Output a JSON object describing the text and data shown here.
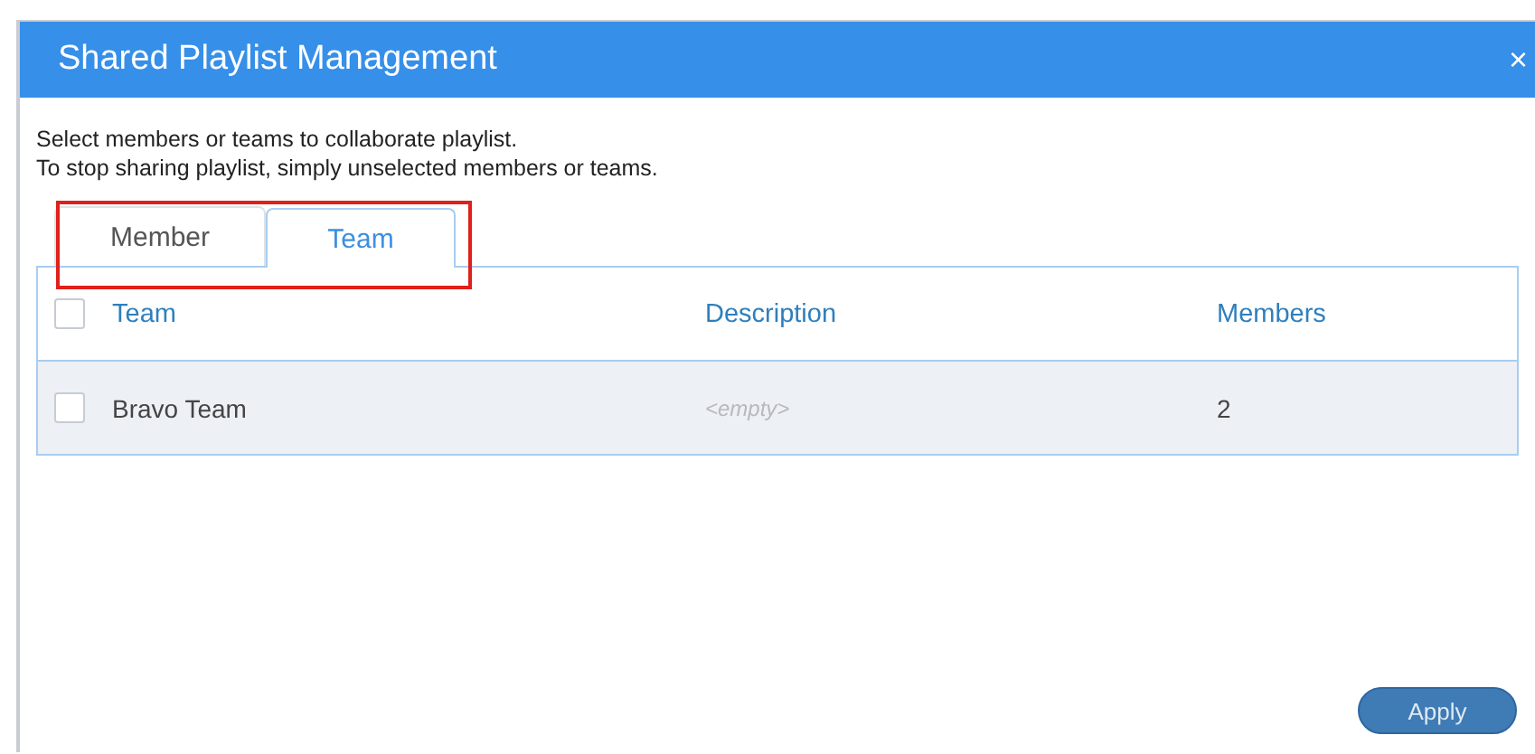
{
  "window": {
    "title": "Shared Playlist Management",
    "close": "×"
  },
  "instructions": [
    "Select members or teams to collaborate playlist.",
    "To stop sharing playlist, simply unselected members or teams."
  ],
  "tabs": [
    {
      "label": "Member",
      "selected": false
    },
    {
      "label": "Team",
      "selected": true
    }
  ],
  "table": {
    "select_all_checked": false,
    "columns": [
      "Team",
      "Description",
      "Members"
    ],
    "rows": [
      {
        "checked": false,
        "cells": [
          "Bravo Team",
          "<empty>",
          "2"
        ],
        "placeholder_cells": [
          false,
          true,
          false
        ]
      }
    ]
  },
  "buttons": [
    "Apply"
  ]
}
